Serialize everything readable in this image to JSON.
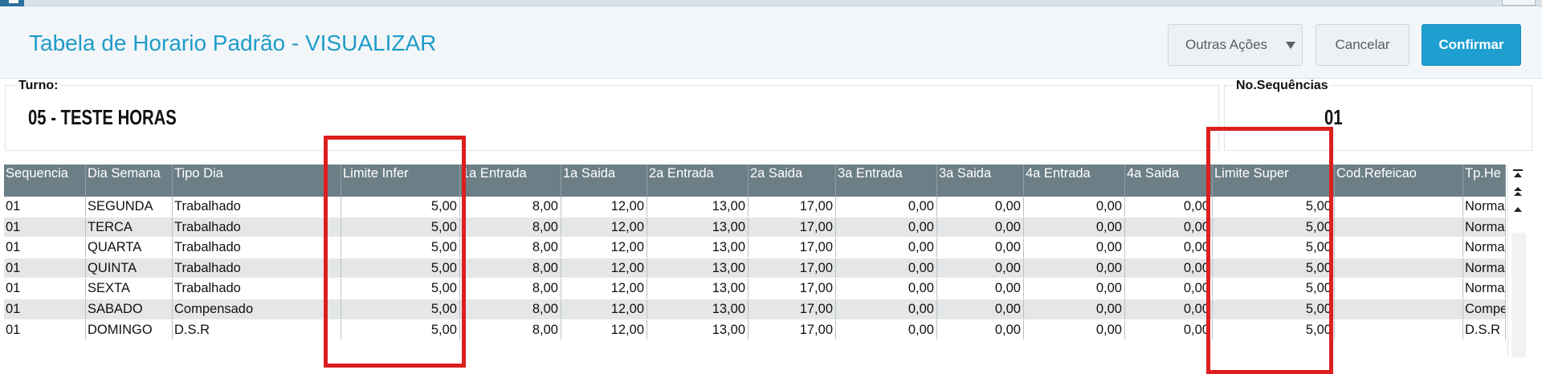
{
  "page": {
    "title": "Tabela de Horario Padrão - VISUALIZAR"
  },
  "actions": {
    "other_label": "Outras Ações",
    "cancel_label": "Cancelar",
    "confirm_label": "Confirmar"
  },
  "fields": {
    "turno_label": "Turno:",
    "turno_value": "05  - TESTE HORAS",
    "seq_label": "No.Sequências",
    "seq_value": "01"
  },
  "table": {
    "columns": [
      "Sequencia",
      "Dia Semana",
      "Tipo Dia",
      "Limite Infer",
      "1a Entrada",
      "1a Saida",
      "2a Entrada",
      "2a Saida",
      "3a Entrada",
      "3a Saida",
      "4a Entrada",
      "4a Saida",
      "Limite Super",
      "Cod.Refeicao",
      "Tp.He N"
    ],
    "rows": [
      [
        "01",
        "SEGUNDA",
        "Trabalhado",
        "5,00",
        "8,00",
        "12,00",
        "13,00",
        "17,00",
        "0,00",
        "0,00",
        "0,00",
        "0,00",
        "5,00",
        "",
        "Normal"
      ],
      [
        "01",
        "TERCA",
        "Trabalhado",
        "5,00",
        "8,00",
        "12,00",
        "13,00",
        "17,00",
        "0,00",
        "0,00",
        "0,00",
        "0,00",
        "5,00",
        "",
        "Normal"
      ],
      [
        "01",
        "QUARTA",
        "Trabalhado",
        "5,00",
        "8,00",
        "12,00",
        "13,00",
        "17,00",
        "0,00",
        "0,00",
        "0,00",
        "0,00",
        "5,00",
        "",
        "Normal"
      ],
      [
        "01",
        "QUINTA",
        "Trabalhado",
        "5,00",
        "8,00",
        "12,00",
        "13,00",
        "17,00",
        "0,00",
        "0,00",
        "0,00",
        "0,00",
        "5,00",
        "",
        "Normal"
      ],
      [
        "01",
        "SEXTA",
        "Trabalhado",
        "5,00",
        "8,00",
        "12,00",
        "13,00",
        "17,00",
        "0,00",
        "0,00",
        "0,00",
        "0,00",
        "5,00",
        "",
        "Normal"
      ],
      [
        "01",
        "SABADO",
        "Compensado",
        "5,00",
        "8,00",
        "12,00",
        "13,00",
        "17,00",
        "0,00",
        "0,00",
        "0,00",
        "0,00",
        "5,00",
        "",
        "Compe"
      ],
      [
        "01",
        "DOMINGO",
        "D.S.R",
        "5,00",
        "8,00",
        "12,00",
        "13,00",
        "17,00",
        "0,00",
        "0,00",
        "0,00",
        "0,00",
        "5,00",
        "",
        "D.S.R"
      ]
    ]
  },
  "icons": {
    "dropdown": "caret-down-icon",
    "scroll_top": "double-chevron-up-icon",
    "scroll_page_up": "chevron-bar-up-icon",
    "scroll_up": "chevron-up-icon"
  },
  "colors": {
    "title": "#1f9cc9",
    "confirm_button": "#1f9fd0",
    "grid_header": "#6d7f86",
    "highlight": "#dd1f1f"
  }
}
